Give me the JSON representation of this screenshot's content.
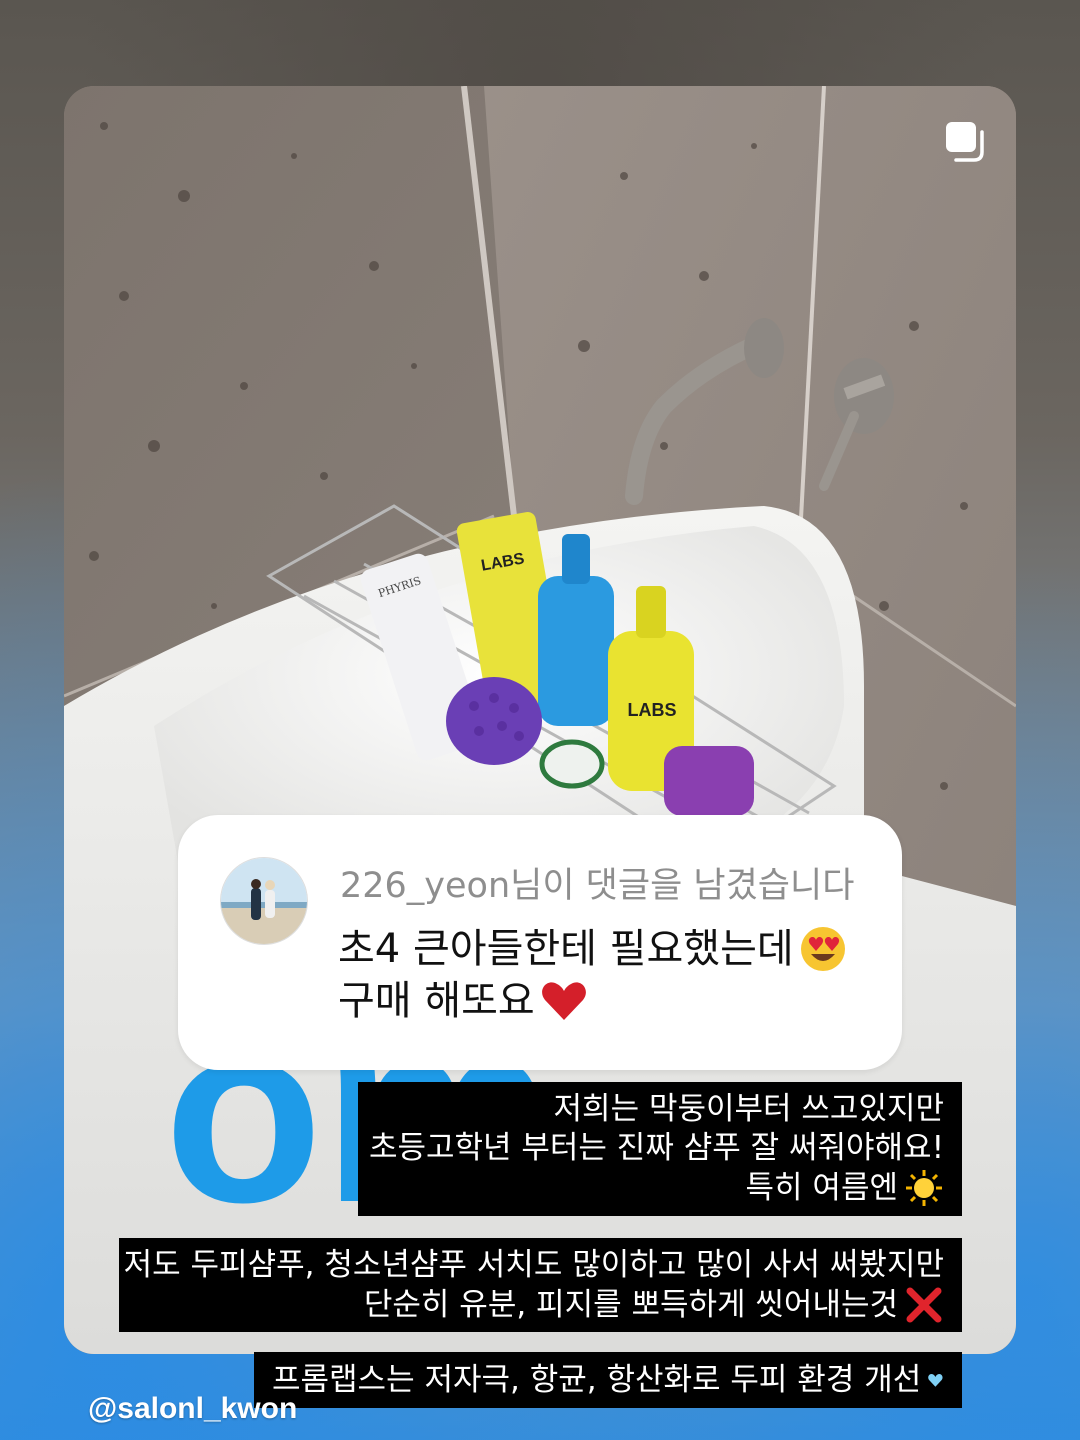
{
  "photo": {
    "bottle_brand_text": "FROM LABS",
    "tube_brand_text": "PHYRIS",
    "big_letters": "om"
  },
  "comment": {
    "header": "226_yeon님이 댓글을 남겼습니다",
    "line1": "초4 큰아들한테 필요했는데",
    "line1_emoji": "heart-eyes-emoji",
    "line2": "구매 해또요",
    "line2_emoji": "red-heart-emoji"
  },
  "captions": {
    "c1_line1": "저희는 막둥이부터 쓰고있지만",
    "c1_line2": "초등고학년 부터는 진짜 샴푸 잘 써줘야해요!",
    "c1_line3": "특히 여름엔",
    "c1_emoji": "sun-emoji",
    "c2_line1": "저도 두피샴푸, 청소년샴푸 서치도 많이하고 많이 사서 써봤지만",
    "c2_line2": "단순히 유분, 피지를 뽀득하게 씻어내는것",
    "c2_emoji": "cross-mark-emoji",
    "c3_line1": "프롬랩스는 저자극, 항균, 항산화로 두피 환경 개선",
    "c3_emoji": "blue-heart-emoji"
  },
  "watermark": "@salonl_kwon",
  "colors": {
    "caption_bg": "#000000",
    "accent_blue": "#1e9be8",
    "bottle_yellow": "#e9e330",
    "bottle_blue": "#2b9ae0",
    "brush_purple": "#6a3fb5"
  }
}
